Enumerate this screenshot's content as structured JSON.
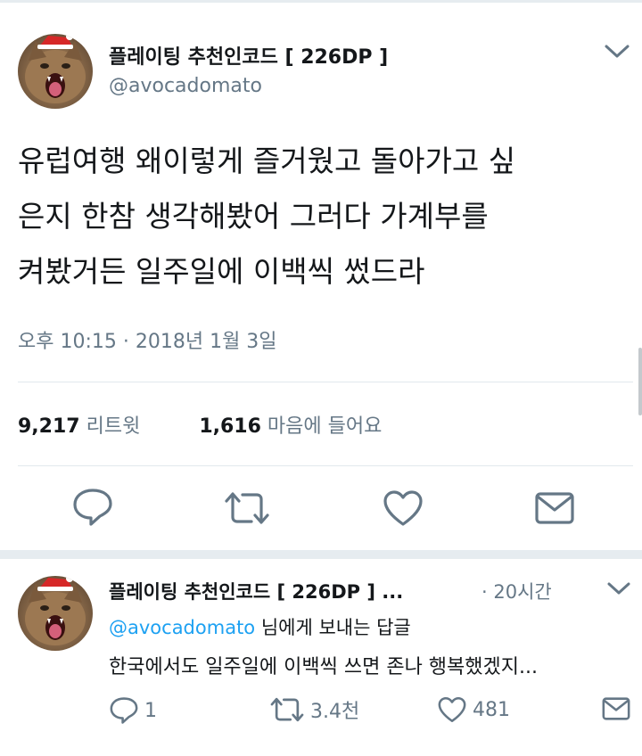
{
  "tweet": {
    "author_name": "플레이팅 추천인코드 [ 226DP ]",
    "author_handle": "@avocadomato",
    "text_lines": [
      "유럽여행 왜이렇게 즐거웠고 돌아가고 싶",
      "은지 한참 생각해봤어 그러다 가계부를",
      "켜봤거든 일주일에 이백씩 썼드라"
    ],
    "timestamp": "오후 10:15 · 2018년 1월 3일",
    "retweets_count": "9,217",
    "retweets_label": "리트윗",
    "likes_count": "1,616",
    "likes_label": "마음에 들어요",
    "actions": [
      "reply-icon",
      "retweet-icon",
      "like-icon",
      "message-icon"
    ]
  },
  "reply": {
    "author_name": "플레이팅 추천인코드 [ 226DP ] ...",
    "time_ago": "· 20시간",
    "mention": "@avocadomato",
    "reply_to_suffix": " 님에게 보내는 답글",
    "text": "한국에서도 일주일에 이백씩 쓰면 존나 행복했겠지...",
    "reply_count": "1",
    "retweet_count": "3.4천",
    "like_count": "481"
  },
  "colors": {
    "text": "#14171a",
    "secondary": "#657786",
    "link": "#1da1f2",
    "divider": "#e1e8ed"
  }
}
